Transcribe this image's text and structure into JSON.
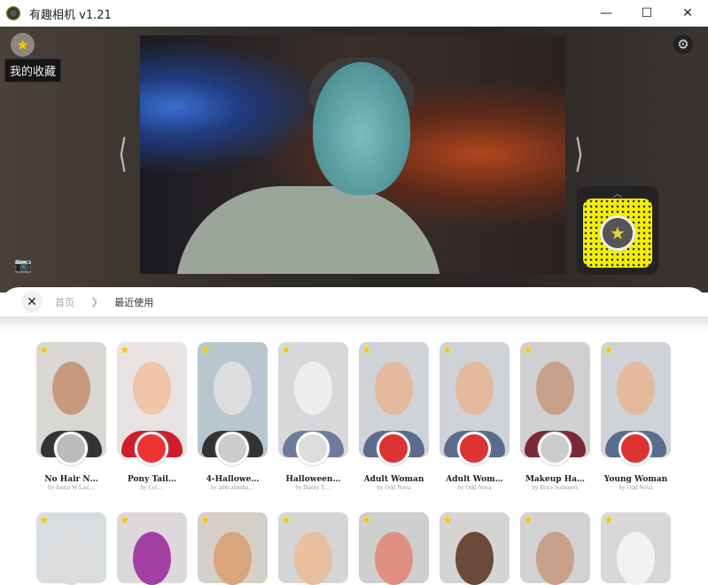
{
  "window": {
    "title": "有趣相机 v1.21",
    "minimize": "—",
    "maximize": "☐",
    "close": "✕"
  },
  "camera": {
    "favorites_label": "我的收藏",
    "prev": "⟨",
    "next": "⟩",
    "icons": {
      "favorites": "star-icon",
      "settings": "gear-icon",
      "capture": "camera-icon"
    },
    "snapcode_chevron": "︿"
  },
  "breadcrumb": {
    "close": "✕",
    "home": "首页",
    "separator": "❯",
    "current": "最近使用"
  },
  "lenses": [
    {
      "name": "No Hair N…",
      "author": "by Justin W Lau…",
      "bg": "#d9d7d4",
      "face": "#c79a7e",
      "body": "#333",
      "av": "#bbb"
    },
    {
      "name": "Pony Tail…",
      "author": "by Cel…",
      "bg": "#e9e3e3",
      "face": "#f0c5a8",
      "body": "#d11c2b",
      "av": "#e33"
    },
    {
      "name": "4-Hallowe…",
      "author": "by athb.almsha…",
      "bg": "#b8c7ce",
      "face": "#ddd",
      "body": "#333",
      "av": "#ccc"
    },
    {
      "name": "Halloween…",
      "author": "by Danny T…",
      "bg": "#d8d8da",
      "face": "#eee",
      "body": "#6c7d9a",
      "av": "#ddd"
    },
    {
      "name": "Adult Woman",
      "author": "by Odd Nova",
      "bg": "#cfd3d8",
      "face": "#e5b99b",
      "body": "#5b6b8c",
      "av": "#d33"
    },
    {
      "name": "Adult Wom…",
      "author": "by Odd Nova",
      "bg": "#cfd3d8",
      "face": "#e5b99b",
      "body": "#5b6b8c",
      "av": "#d33"
    },
    {
      "name": "Makeup Ha…",
      "author": "by Brice Sommers",
      "bg": "#d0d0d0",
      "face": "#c9a08a",
      "body": "#7a2a35",
      "av": "#ccc"
    },
    {
      "name": "Young Woman",
      "author": "by Odd Nova",
      "bg": "#cfd3d8",
      "face": "#e5b99b",
      "body": "#5b6b8c",
      "av": "#d33"
    }
  ],
  "lenses_row2": [
    {
      "bg": "#d8dde0",
      "face": "#ddd"
    },
    {
      "bg": "#dcd8dc",
      "face": "#a23fa2"
    },
    {
      "bg": "#d6cfc8",
      "face": "#d9a57f"
    },
    {
      "bg": "#d5d5d5",
      "face": "#e8c0a0"
    },
    {
      "bg": "#cfcfd0",
      "face": "#e09080"
    },
    {
      "bg": "#d6d4d2",
      "face": "#6b4a3a"
    },
    {
      "bg": "#d2d2d2",
      "face": "#c9a08a"
    },
    {
      "bg": "#d8d8d8",
      "face": "#f2f2f2"
    }
  ]
}
